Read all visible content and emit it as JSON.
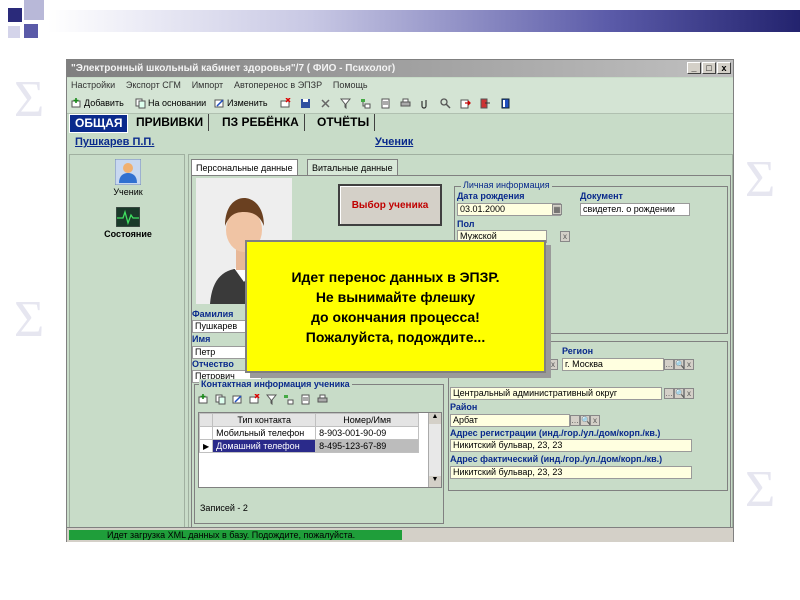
{
  "window": {
    "title": "\"Электронный школьный кабинет здоровья\"/7 ( ФИО - Психолог)",
    "controls": [
      "_",
      "□",
      "x"
    ]
  },
  "menu": [
    "Настройки",
    "Экспорт СГМ",
    "Импорт",
    "Автоперенос в ЭПЗР",
    "Помощь"
  ],
  "toolbar": {
    "add_label": "Добавить",
    "based_on_label": "На основании",
    "edit_label": "Изменить"
  },
  "main_tabs": [
    "ОБЩАЯ",
    "ПРИВИВКИ",
    "ПЗ РЕБЁНКА",
    "ОТЧЁТЫ"
  ],
  "header": {
    "user_name": "Пушкарев П.П.",
    "role": "Ученик"
  },
  "sidebar": {
    "items": [
      {
        "label": "Ученик",
        "icon": "student-icon"
      },
      {
        "label": "Состояние",
        "icon": "ecg-monitor-icon"
      }
    ]
  },
  "subtabs": [
    "Персональные данные",
    "Витальные данные"
  ],
  "personal": {
    "select_button": "Выбор ученика",
    "group_title": "Личная информация",
    "birth_date_label": "Дата рождения",
    "birth_date": "03.01.2000",
    "document_label": "Документ",
    "document": "свидетел. о рождении",
    "gender_label": "Пол",
    "gender": "Мужской",
    "surname_label": "Фамилия",
    "surname": "Пушкарев",
    "name_label": "Имя",
    "name": "Петр",
    "patronymic_label": "Отчество",
    "patronymic": "Петрович"
  },
  "address": {
    "region_label": "Регион",
    "region": "г. Москва",
    "okrug": "Центральный административный округ",
    "district_label": "Район",
    "district": "Арбат",
    "reg_address_label": "Адрес регистрации (инд./гор./ул./дом/корп./кв.)",
    "reg_address": "Никитский бульвар, 23, 23",
    "fact_address_label": "Адрес фактический (инд./гор./ул./дом/корп./кв.)",
    "fact_address": "Никитский бульвар, 23, 23"
  },
  "contacts": {
    "title": "Контактная информация ученика",
    "columns": [
      "Тип контакта",
      "Номер/Имя"
    ],
    "rows": [
      {
        "type": "Мобильный телефон",
        "value": "8-903-001-90-09"
      },
      {
        "type": "Домашний телефон",
        "value": "8-495-123-67-89"
      }
    ],
    "records": "Записей - 2"
  },
  "overlay": {
    "lines": [
      "Идет перенос данных в ЭПЗР.",
      "Не вынимайте флешку",
      "до окончания процесса!",
      "Пожалуйста, подождите..."
    ]
  },
  "status": {
    "text": "Идет загрузка XML данных в базу. Подождите, пожалуйста.",
    "progress": 0.5,
    "progress_color": "#1f9e3a"
  },
  "colors": {
    "accent": "#0a2a8c",
    "window_bg": "#c8dcc8",
    "overlay_bg": "#ffff00",
    "field_bg": "#ffffe0"
  }
}
